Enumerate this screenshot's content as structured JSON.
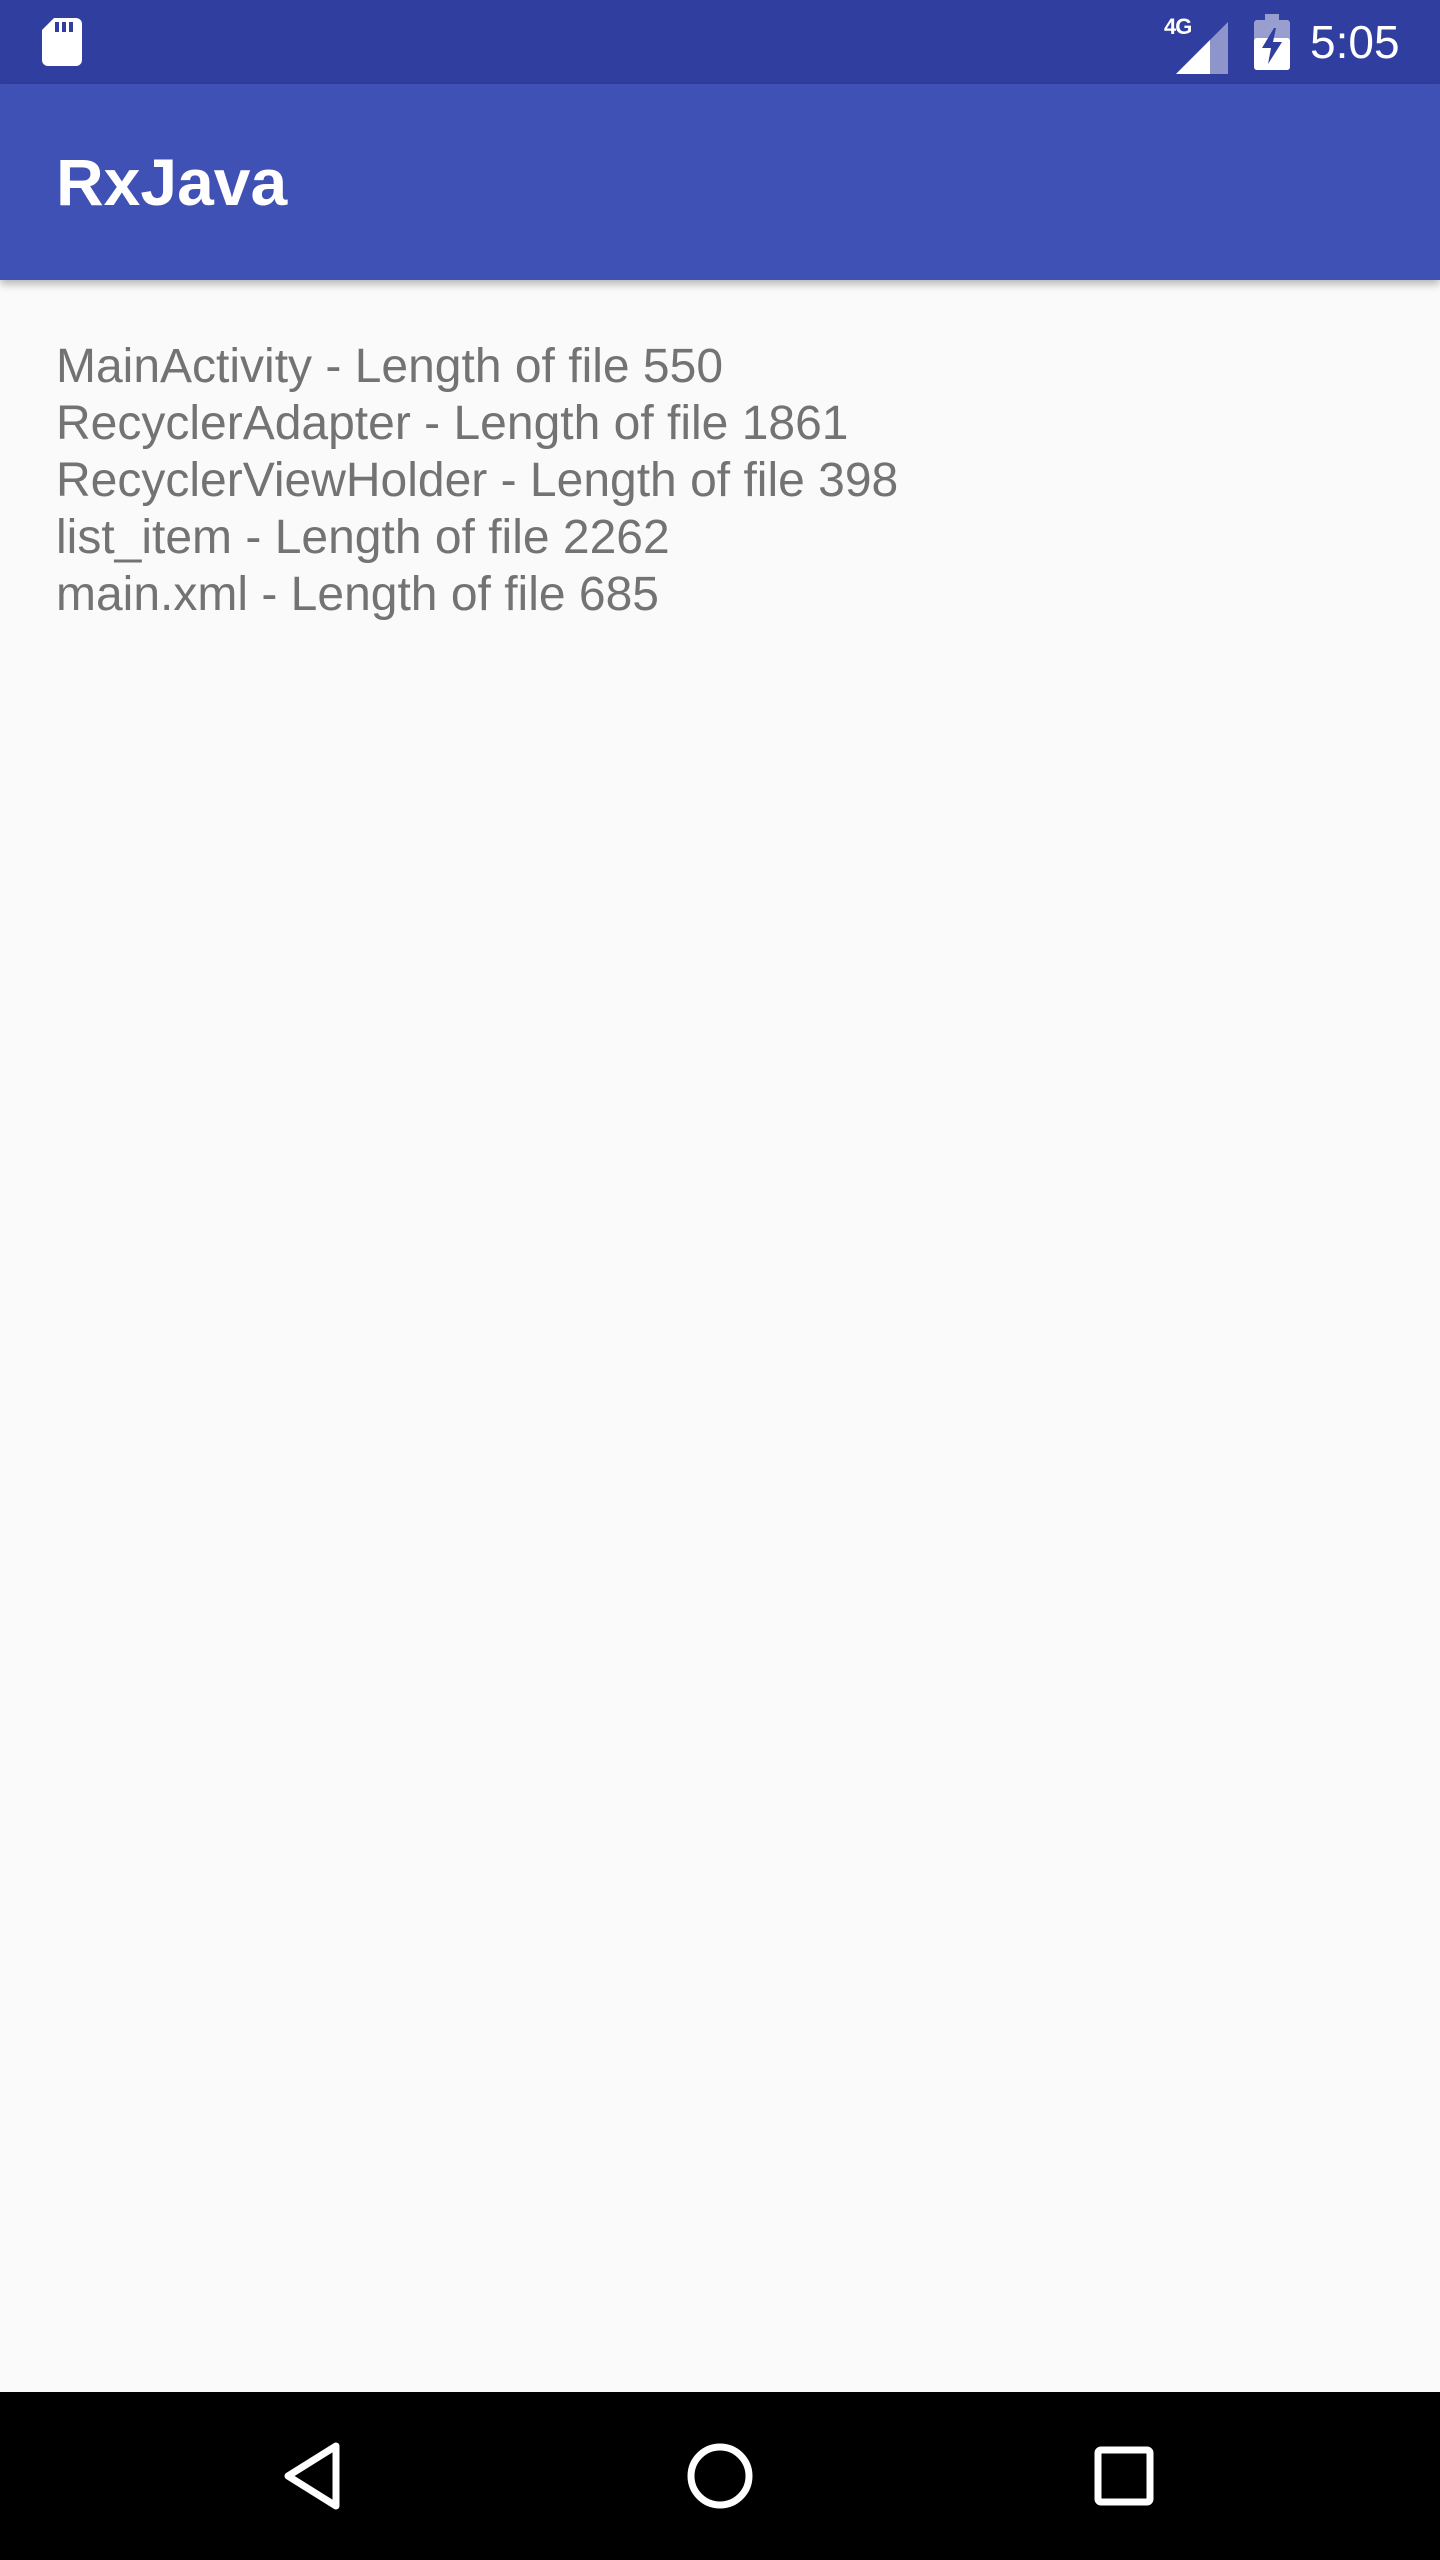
{
  "status_bar": {
    "network_type": "4G",
    "time": "5:05",
    "icons": [
      "sd-card-icon",
      "signal-icon",
      "battery-charging-icon"
    ]
  },
  "app_bar": {
    "title": "RxJava"
  },
  "files": [
    {
      "text": "MainActivity - Length of file 550"
    },
    {
      "text": "RecyclerAdapter - Length of file 1861"
    },
    {
      "text": "RecyclerViewHolder - Length of file 398"
    },
    {
      "text": "list_item - Length of file 2262"
    },
    {
      "text": "main.xml - Length of file 685"
    }
  ],
  "nav_bar": {
    "icons": [
      "back-icon",
      "home-icon",
      "recents-icon"
    ]
  },
  "colors": {
    "status_bar": "#303f9f",
    "app_bar": "#3f51b5",
    "background": "#fafafa",
    "text": "#737373"
  }
}
